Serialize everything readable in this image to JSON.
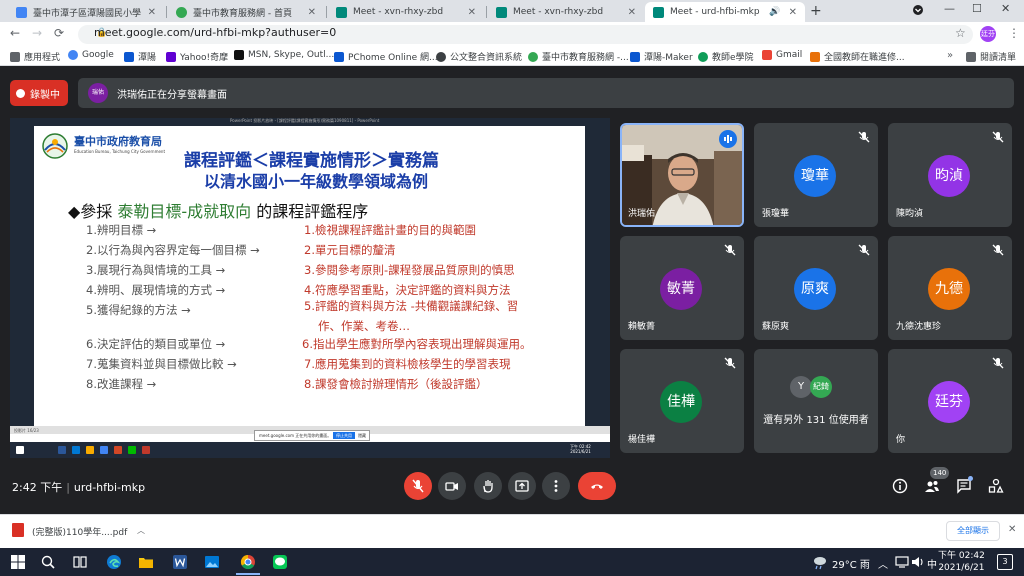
{
  "browser": {
    "tabs": [
      {
        "label": "臺中市潭子區潭陽國民小學",
        "color": "#4285f4"
      },
      {
        "label": "臺中市教育服務網 - 首頁",
        "color": "#34a853"
      },
      {
        "label": "Meet - xvn-rhxy-zbd",
        "color": "#00897b"
      },
      {
        "label": "Meet - xvn-rhxy-zbd",
        "color": "#00897b"
      },
      {
        "label": "Meet - urd-hfbi-mkp",
        "color": "#00897b"
      }
    ],
    "new_tab": "+",
    "window_controls": {
      "minimize": "—",
      "maximize": "☐",
      "close": "✕"
    },
    "url": "meet.google.com/urd-hfbi-mkp?authuser=0",
    "profile_initials": "廷芬",
    "bookmarks": [
      {
        "label": "應用程式",
        "color": "#5f6368"
      },
      {
        "label": "Google",
        "color": "#4285f4"
      },
      {
        "label": "潭陽",
        "color": "#0b57d0"
      },
      {
        "label": "Yahoo!奇摩",
        "color": "#6001d2"
      },
      {
        "label": "MSN, Skype, Outl...",
        "color": "#111111"
      },
      {
        "label": "PChome Online 網...",
        "color": "#0b57d0"
      },
      {
        "label": "公文整合資訊系統",
        "color": "#3c4043"
      },
      {
        "label": "臺中市教育服務網 -...",
        "color": "#34a853"
      },
      {
        "label": "潭陽-Maker",
        "color": "#0b57d0"
      },
      {
        "label": "教師e學院",
        "color": "#0f9d58"
      },
      {
        "label": "Gmail",
        "color": "#ea4335"
      },
      {
        "label": "全國教師在職進修...",
        "color": "#e8710a"
      }
    ],
    "bookmarks_more": "»",
    "reading_list": "閱讀清單"
  },
  "meet": {
    "recording_label": "錄製中",
    "presenter_avatar": "瑞佑",
    "presenter_text": "洪瑞佑正在分享螢幕畫面",
    "time": "2:42 下午",
    "meeting_code": "urd-hfbi-mkp",
    "participant_count": "140",
    "participants": [
      {
        "name": "洪瑞佑",
        "avatar": "",
        "color": "",
        "speaking": true
      },
      {
        "name": "張瓊華",
        "avatar": "瓊華",
        "color": "#1a73e8"
      },
      {
        "name": "陳昀湞",
        "avatar": "昀湞",
        "color": "#9334e6"
      },
      {
        "name": "賴敏菁",
        "avatar": "敏菁",
        "color": "#7b1fa2"
      },
      {
        "name": "蘇原爽",
        "avatar": "原爽",
        "color": "#1a73e8"
      },
      {
        "name": "九德沈惠珍",
        "avatar": "九德",
        "color": "#e8710a"
      },
      {
        "name": "楊佳樺",
        "avatar": "佳樺",
        "color": "#0b8043"
      },
      {
        "name": "你",
        "avatar": "廷芬",
        "color": "#a142f4"
      }
    ],
    "others": {
      "text": "還有另外 131 位使用者",
      "avatar1": "Y",
      "avatar2": "紀錡"
    }
  },
  "slide": {
    "window_title": "PowerPoint 投影片放映 - [課程評鑑(課程實施情形)實務篇1090811] - PowerPoint",
    "logo_title": "臺中市政府教育局",
    "logo_sub": "Education Bureau, Taichung City Government",
    "title": "課程評鑑＜課程實施情形＞實務篇",
    "subtitle": "以清水國小一年級數學領域為例",
    "heading_prefix": "◆參採 ",
    "heading_highlight": "泰勒目標-成就取向",
    "heading_suffix": " 的課程評鑑程序",
    "left_items": [
      "1.辨明目標 →",
      "2.以行為與內容界定每一個目標 →",
      "3.展現行為與情境的工具 →",
      "4.辨明、展現情境的方式 →",
      "5.獲得紀錄的方法 →",
      "6.決定評估的類目或單位 →",
      "7.蒐集資料並與目標做比較 →",
      "8.改進課程 →"
    ],
    "right_items": [
      "1.檢視課程評鑑計畫的目的與範圍",
      "2.單元目標的釐清",
      "3.參閱參考原則-課程發展品質原則的慎思",
      "4.符應學習重點，決定評鑑的資料與方法",
      "5.評鑑的資料與方法 -共備觀議課紀錄、習",
      "作、作業、考卷…",
      "6.指出學生應對所學內容表現出理解與運用。",
      "7.應用蒐集到的資料檢核學生的學習表現",
      "8.課發會檢討辦理情形（後設評鑑）"
    ],
    "slide_counter": "投影片 16/23",
    "share_banner": "meet.google.com 正在共用你的畫面。",
    "share_stop": "停止共用",
    "share_hide": "隱藏",
    "mini_clock": "下午 02:42\n2021/6/21"
  },
  "downloads": {
    "file": "(完整版)110學年....pdf",
    "show_all": "全部顯示",
    "close": "✕"
  },
  "taskbar": {
    "weather": "29°C 雨",
    "ime": "中",
    "time": "下午 02:42",
    "date": "2021/6/21",
    "notifications": "3"
  }
}
